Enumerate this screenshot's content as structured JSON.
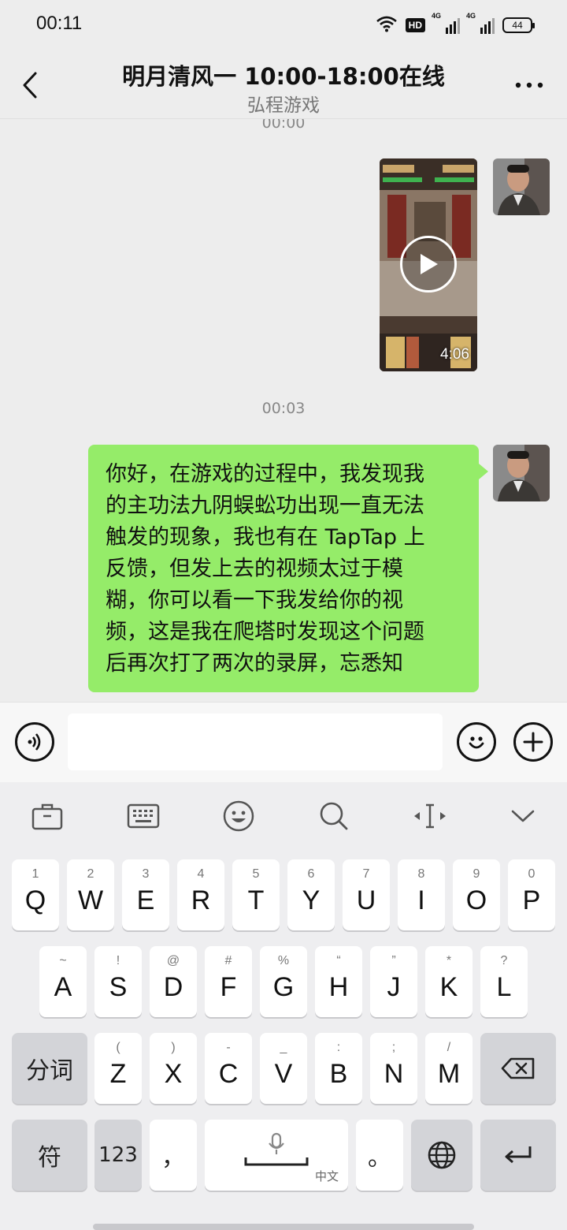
{
  "status_bar": {
    "time": "00:11",
    "hd_label": "HD",
    "network_1": "4G",
    "network_2": "4G",
    "battery": "44"
  },
  "header": {
    "title": "明月清风一 10:00-18:00在线",
    "subtitle": "弘程游戏"
  },
  "chat": {
    "timestamp_1": "00:00",
    "video_duration": "4:06",
    "timestamp_2": "00:03",
    "message_lines": [
      "你好，在游戏的过程中，我发现我",
      "的主功法九阴蜈蚣功出现一直无法",
      "触发的现象，我也有在 TapTap 上",
      "反馈，但发上去的视频太过于模",
      "糊，你可以看一下我发给你的视",
      "频，这是我在爬塔时发现这个问题",
      "后再次打了两次的录屏，忘悉知"
    ]
  },
  "input": {
    "value": ""
  },
  "keyboard": {
    "row1": [
      {
        "hint": "1",
        "key": "Q"
      },
      {
        "hint": "2",
        "key": "W"
      },
      {
        "hint": "3",
        "key": "E"
      },
      {
        "hint": "4",
        "key": "R"
      },
      {
        "hint": "5",
        "key": "T"
      },
      {
        "hint": "6",
        "key": "Y"
      },
      {
        "hint": "7",
        "key": "U"
      },
      {
        "hint": "8",
        "key": "I"
      },
      {
        "hint": "9",
        "key": "O"
      },
      {
        "hint": "0",
        "key": "P"
      }
    ],
    "row2": [
      {
        "hint": "~",
        "key": "A"
      },
      {
        "hint": "!",
        "key": "S"
      },
      {
        "hint": "@",
        "key": "D"
      },
      {
        "hint": "#",
        "key": "F"
      },
      {
        "hint": "%",
        "key": "G"
      },
      {
        "hint": "“",
        "key": "H"
      },
      {
        "hint": "”",
        "key": "J"
      },
      {
        "hint": "*",
        "key": "K"
      },
      {
        "hint": "?",
        "key": "L"
      }
    ],
    "row3": [
      {
        "hint": "(",
        "key": "Z"
      },
      {
        "hint": ")",
        "key": "X"
      },
      {
        "hint": "-",
        "key": "C"
      },
      {
        "hint": "_",
        "key": "V"
      },
      {
        "hint": ":",
        "key": "B"
      },
      {
        "hint": ";",
        "key": "N"
      },
      {
        "hint": "/",
        "key": "M"
      }
    ],
    "segment_label": "分词",
    "symbol_label": "符",
    "numbers_label": "123",
    "comma": "，",
    "period": "。",
    "space_language": "中文"
  }
}
